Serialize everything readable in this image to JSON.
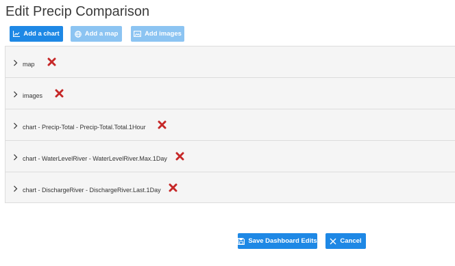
{
  "page": {
    "title": "Edit Precip Comparison"
  },
  "toolbar": {
    "add_chart_label": "Add a chart",
    "add_map_label": "Add a map",
    "add_images_label": "Add images"
  },
  "items": [
    {
      "label": "map"
    },
    {
      "label": "images"
    },
    {
      "label": "chart - Precip-Total - Precip-Total.Total.1Hour"
    },
    {
      "label": "chart - WaterLevelRiver - WaterLevelRiver.Max.1Day"
    },
    {
      "label": "chart - DischargeRiver - DischargeRiver.Last.1Day"
    }
  ],
  "footer": {
    "save_label": "Save Dashboard Edits",
    "cancel_label": "Cancel"
  },
  "colors": {
    "primary": "#1e88e5",
    "disabled": "#8cc4f2",
    "delete": "#c62828"
  }
}
